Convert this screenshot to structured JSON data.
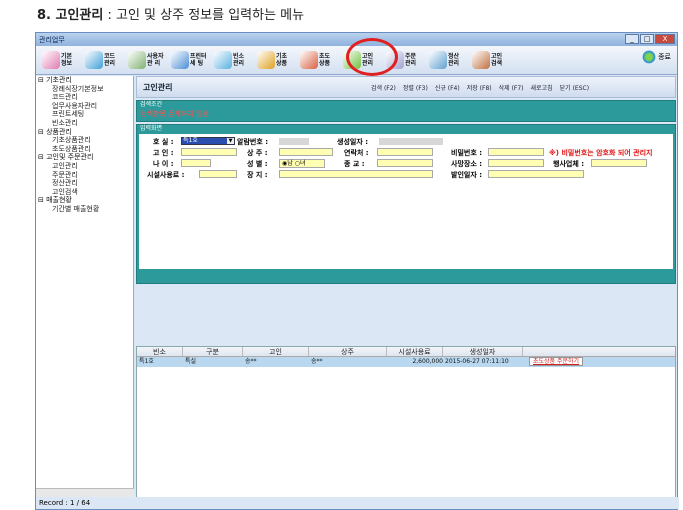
{
  "heading": {
    "number": "8. 고인관리",
    "subtitle": " : 고인 및 상주 정보를 입력하는 메뉴"
  },
  "window": {
    "title": "관리업무",
    "close": "X",
    "min": "_",
    "max": "□"
  },
  "toolbar": [
    {
      "label": "기본 정보",
      "color": "#e07ab0"
    },
    {
      "label": "코드 관리",
      "color": "#3f9fd6"
    },
    {
      "label": "사용자 관 리",
      "color": "#7fb070"
    },
    {
      "label": "프린터 세 팅",
      "color": "#4a8ed6"
    },
    {
      "label": "빈소 관리",
      "color": "#5ab0e0"
    },
    {
      "label": "기초 상품",
      "color": "#e0a020"
    },
    {
      "label": "초도 상품",
      "color": "#d86040"
    },
    {
      "label": "고인 관리",
      "color": "#70c040"
    },
    {
      "label": "주문 관리",
      "color": "#a0a0d0"
    },
    {
      "label": "정산 관리",
      "color": "#60a0d0"
    },
    {
      "label": "고인 검색",
      "color": "#c07040"
    }
  ],
  "exit_label": "종료",
  "tree": [
    {
      "type": "g",
      "text": "⊟ 기초관리"
    },
    {
      "type": "c",
      "text": "장례식장기본정보"
    },
    {
      "type": "c",
      "text": "코드관리"
    },
    {
      "type": "c",
      "text": "업무사용자관리"
    },
    {
      "type": "c",
      "text": "프린트세팅"
    },
    {
      "type": "c",
      "text": "빈소관리"
    },
    {
      "type": "g",
      "text": "⊟ 상품관리"
    },
    {
      "type": "c",
      "text": "기초상품관리"
    },
    {
      "type": "c",
      "text": "초도상품관리"
    },
    {
      "type": "g",
      "text": "⊟ 고인및 주문관리"
    },
    {
      "type": "c",
      "text": "고인관리"
    },
    {
      "type": "c",
      "text": "주문관리"
    },
    {
      "type": "c",
      "text": "정산관리"
    },
    {
      "type": "c",
      "text": "고인검색"
    },
    {
      "type": "g",
      "text": "⊟ 매출현황"
    },
    {
      "type": "c",
      "text": "기간별 매출현황"
    }
  ],
  "status": "Record : 1 / 64",
  "main": {
    "title": "고인관리",
    "actions": [
      "검색 (F2)",
      "정렬 (F3)",
      "신규 (F4)",
      "저장 (F8)",
      "삭제 (F7)",
      "새로고침",
      "닫기 (ESC)"
    ],
    "search_label": "검색조건",
    "search_msg": "검색항목 존재하지 않음",
    "input_label": "입력화면",
    "form": {
      "hosil": "호 실 :",
      "hosil_value": "특1호",
      "alarm": "알람번호 :",
      "created": "생성일자 :",
      "goin": "고 인 :",
      "sangju": "상 주 :",
      "contact": "연락처 :",
      "password": "비밀번호 :",
      "pw_note": "※) 비밀번호는 암호화 되어 관리지",
      "age": "나 이 :",
      "gender": "성 별 :",
      "male": "남",
      "female": "녀",
      "religion": "종 교 :",
      "death_place": "사망장소 :",
      "event_co": "행사업체 :",
      "facility_fee": "시설사용료 :",
      "burial": "장 지 :",
      "departure": "발인일자 :"
    },
    "grid": {
      "headers": [
        "빈소",
        "구분",
        "고인",
        "상주",
        "시설사용료",
        "생성일자"
      ],
      "rows": [
        {
          "binso": "특1호",
          "gubun": "특실",
          "goin": "송**",
          "sangju": "송**",
          "fee": "2,600,000",
          "date": "2015-06-27 07:11:10",
          "link": "초도상품 주문하기"
        }
      ]
    }
  }
}
